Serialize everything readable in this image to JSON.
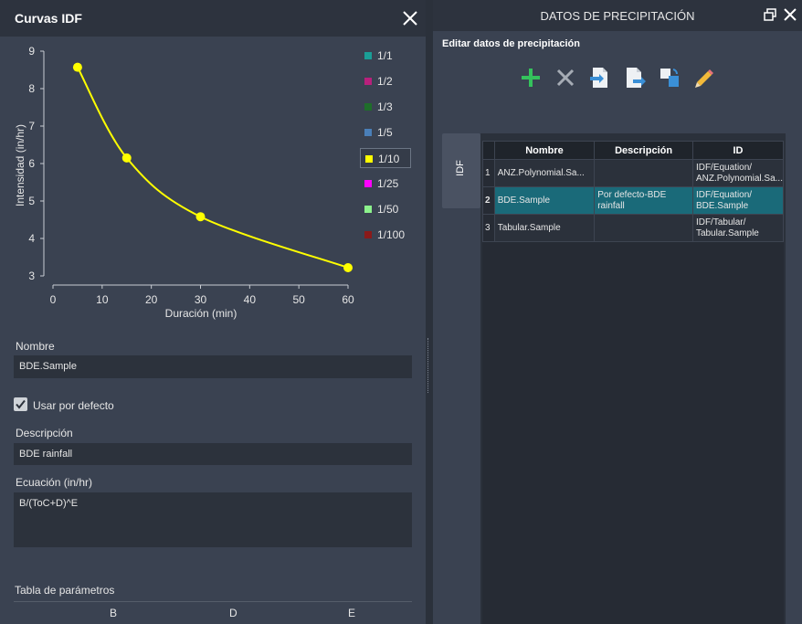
{
  "left": {
    "title": "Curvas IDF",
    "chart_data": {
      "type": "line",
      "xlabel": "Duración (min)",
      "ylabel": "Intensidad (in/hr)",
      "xlim": [
        0,
        60
      ],
      "ylim": [
        3,
        9
      ],
      "xticks": [
        0,
        10,
        20,
        30,
        40,
        50,
        60
      ],
      "yticks": [
        3,
        4,
        5,
        6,
        7,
        8,
        9
      ],
      "series": [
        {
          "name": "1/10",
          "color": "#ffff00",
          "x": [
            5,
            15,
            30,
            60
          ],
          "y": [
            8.57,
            6.15,
            4.58,
            3.22
          ]
        }
      ],
      "legend": [
        {
          "label": "1/1",
          "color": "#1a9e96"
        },
        {
          "label": "1/2",
          "color": "#b8207c"
        },
        {
          "label": "1/3",
          "color": "#1f6e2a"
        },
        {
          "label": "1/5",
          "color": "#4a7fb8"
        },
        {
          "label": "1/10",
          "color": "#ffff00",
          "selected": true
        },
        {
          "label": "1/25",
          "color": "#ff00ff"
        },
        {
          "label": "1/50",
          "color": "#8cf28c"
        },
        {
          "label": "1/100",
          "color": "#8a1a1a"
        }
      ],
      "legend_position": "right"
    },
    "nombre_label": "Nombre",
    "nombre_value": "BDE.Sample",
    "default_label": "Usar por defecto",
    "default_checked": true,
    "descripcion_label": "Descripción",
    "descripcion_value": "BDE rainfall",
    "ecuacion_label": "Ecuación (in/hr)",
    "ecuacion_value": "B/(ToC+D)^E",
    "tabla_label": "Tabla de parámetros",
    "tabla_columns": [
      "B",
      "D",
      "E"
    ]
  },
  "right": {
    "title": "DATOS DE PRECIPITACIÓN",
    "edit_label": "Editar datos de precipitación",
    "toolbar_icons": [
      "add-icon",
      "delete-icon",
      "import-icon",
      "export-icon",
      "copy-icon",
      "edit-pencil-icon"
    ],
    "side_tab": "IDF",
    "columns": [
      "Nombre",
      "Descripción",
      "ID"
    ],
    "rows": [
      {
        "num": "1",
        "nombre": "ANZ.Polynomial.Sa...",
        "descripcion": "",
        "id": "IDF/Equation/ ANZ.Polynomial.Sa..."
      },
      {
        "num": "2",
        "nombre": "BDE.Sample",
        "descripcion": "Por defecto-BDE rainfall",
        "id": "IDF/Equation/ BDE.Sample",
        "selected": true
      },
      {
        "num": "3",
        "nombre": "Tabular.Sample",
        "descripcion": "",
        "id": "IDF/Tabular/ Tabular.Sample"
      }
    ]
  }
}
